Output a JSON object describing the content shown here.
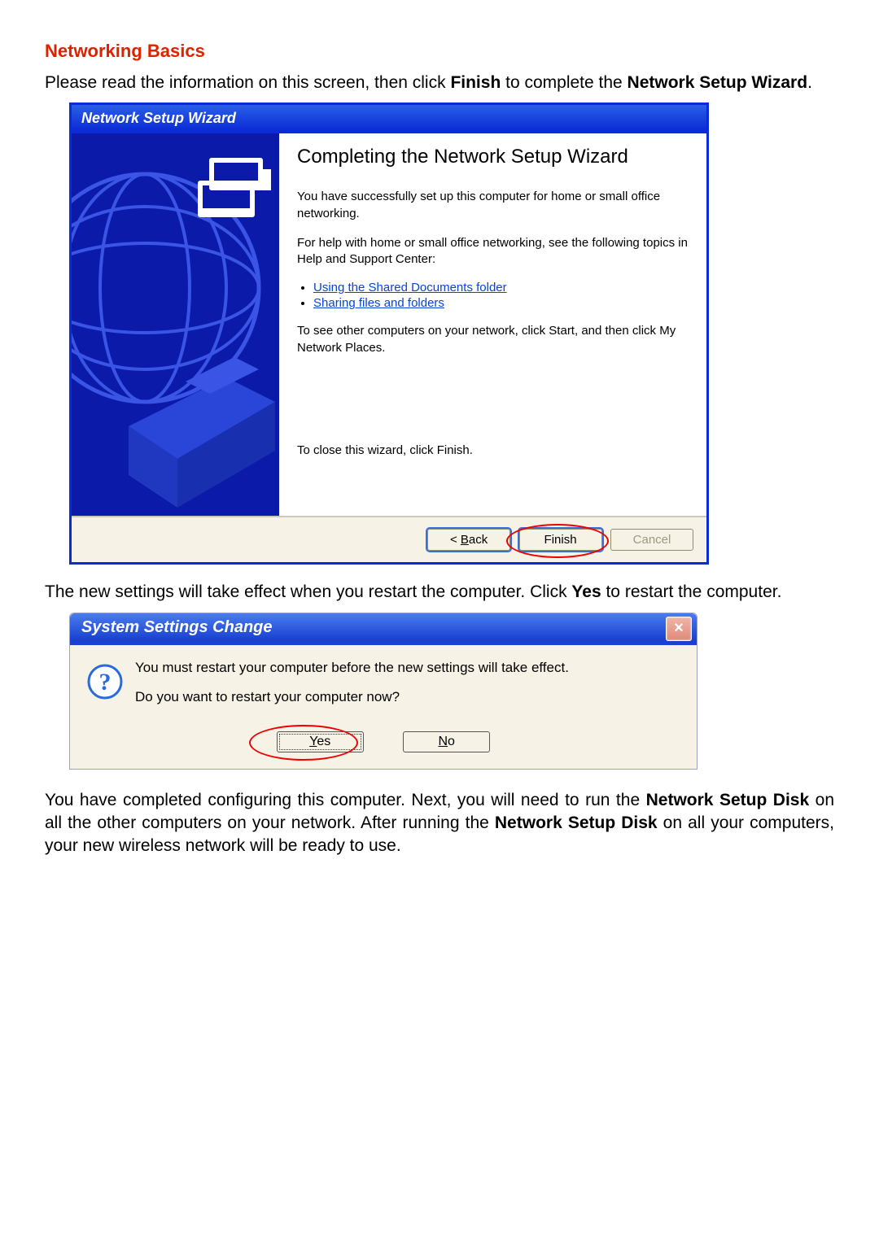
{
  "doc": {
    "heading": "Networking Basics",
    "intro_pre": "Please read the information on this screen, then click ",
    "intro_bold1": "Finish",
    "intro_mid": " to complete the ",
    "intro_bold2": "Network Setup Wizard",
    "intro_post": ".",
    "para2_pre": "The new settings will take effect when you restart the computer.  Click ",
    "para2_bold": "Yes",
    "para2_post": " to restart the computer.",
    "para3_a": "You have completed configuring this computer.  Next, you will need to run the ",
    "para3_b1": "Network Setup Disk",
    "para3_c": " on all the other computers on your network.  After running the ",
    "para3_b2": "Network Setup Disk",
    "para3_d": " on all your computers, your new wireless network will be ready to use."
  },
  "wizard": {
    "title": "Network Setup Wizard",
    "heading": "Completing the Network Setup Wizard",
    "p1": "You have successfully set up this computer for home or small office networking.",
    "p2": "For help with home or small office networking, see the following topics in Help and Support Center:",
    "link1": "Using the Shared Documents folder",
    "link2": "Sharing files and folders",
    "p3": "To see other computers on your network, click Start, and then click My Network Places.",
    "p4": "To close this wizard, click Finish.",
    "btn_back_u": "B",
    "btn_back_rest": "ack",
    "btn_back_prefix": "< ",
    "btn_finish": "Finish",
    "btn_cancel": "Cancel"
  },
  "dialog": {
    "title": "System Settings Change",
    "close": "×",
    "line1": "You must restart your computer before the new settings will take effect.",
    "line2": "Do you want to restart your computer now?",
    "yes_u": "Y",
    "yes_rest": "es",
    "no_u": "N",
    "no_rest": "o"
  }
}
